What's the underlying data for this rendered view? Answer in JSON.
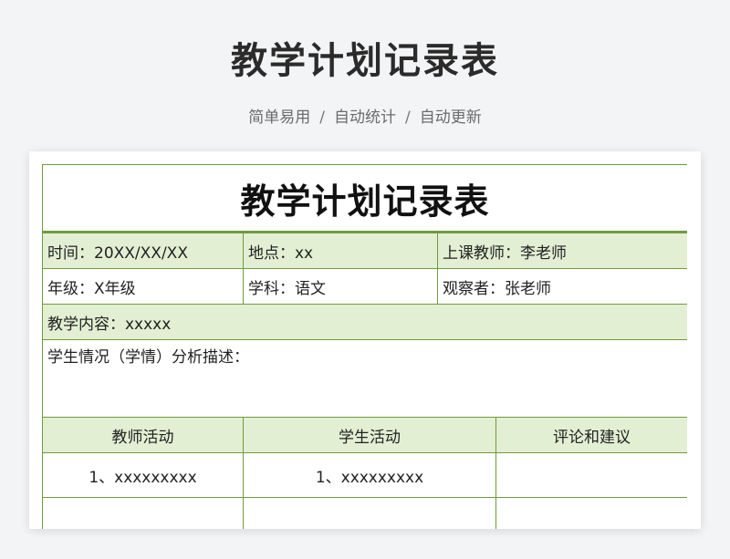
{
  "header": {
    "title": "教学计划记录表",
    "subtitle_parts": [
      "简单易用",
      "自动统计",
      "自动更新"
    ],
    "separator": "/"
  },
  "sheet": {
    "title": "教学计划记录表",
    "row1": {
      "time": "时间：20XX/XX/XX",
      "place": "地点：xx",
      "teacher": "上课教师：李老师"
    },
    "row2": {
      "grade": "年级：X年级",
      "subject": "学科：语文",
      "observer": "观察者：张老师"
    },
    "content": "教学内容：xxxxx",
    "analysis": "学生情况（学情）分析描述：",
    "columns": [
      "教师活动",
      "学生活动",
      "评论和建议"
    ],
    "rows": [
      {
        "teacher_activity": "1、xxxxxxxxx",
        "student_activity": "1、xxxxxxxxx",
        "comment": ""
      }
    ]
  },
  "colors": {
    "border": "#6f9b3d",
    "header_fill": "#e2efd3",
    "background": "#f3f4f6"
  }
}
